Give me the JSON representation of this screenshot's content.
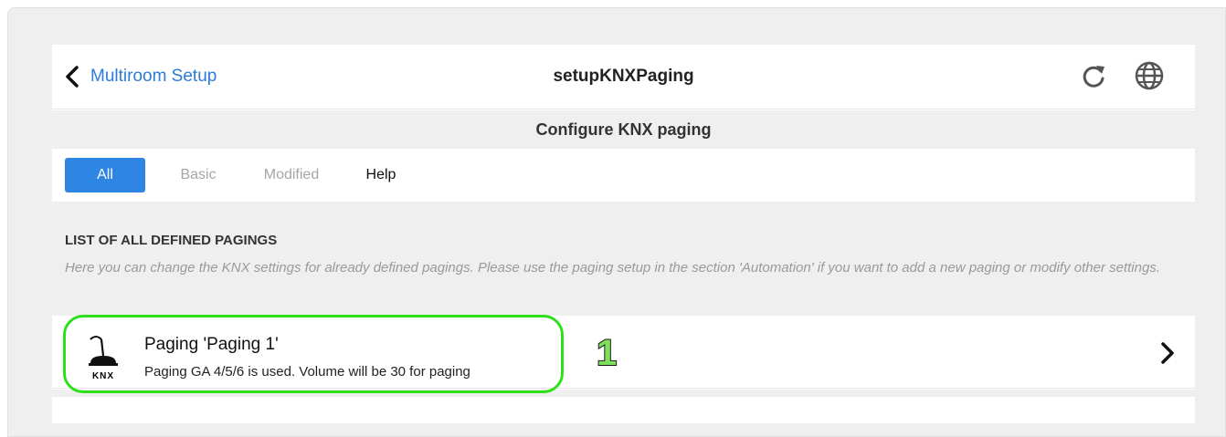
{
  "header": {
    "back_label": "Multiroom Setup",
    "title": "setupKNXPaging",
    "icons": [
      "chevron-left-icon",
      "refresh-icon",
      "globe-icon"
    ]
  },
  "subheader": {
    "title": "Configure KNX paging"
  },
  "tabs": [
    {
      "label": "All",
      "active": true
    },
    {
      "label": "Basic",
      "active": false
    },
    {
      "label": "Modified",
      "active": false
    },
    {
      "label": "Help",
      "active": false
    }
  ],
  "section": {
    "title": "LIST OF ALL DEFINED PAGINGS",
    "description": "Here you can change the KNX settings for already defined pagings. Please use the paging setup in the section 'Automation' if you want to add a new paging or modify other settings."
  },
  "pagings": [
    {
      "title": "Paging 'Paging 1'",
      "subtitle": "Paging GA 4/5/6 is used. Volume will be 30 for paging",
      "icon": "microphone-icon",
      "icon_label": "KNX"
    }
  ],
  "annotation": {
    "marker": "1",
    "highlight_color": "#2ee01a"
  },
  "colors": {
    "accent": "#2f86e2",
    "link": "#2b7bd8",
    "background": "#efefef"
  }
}
